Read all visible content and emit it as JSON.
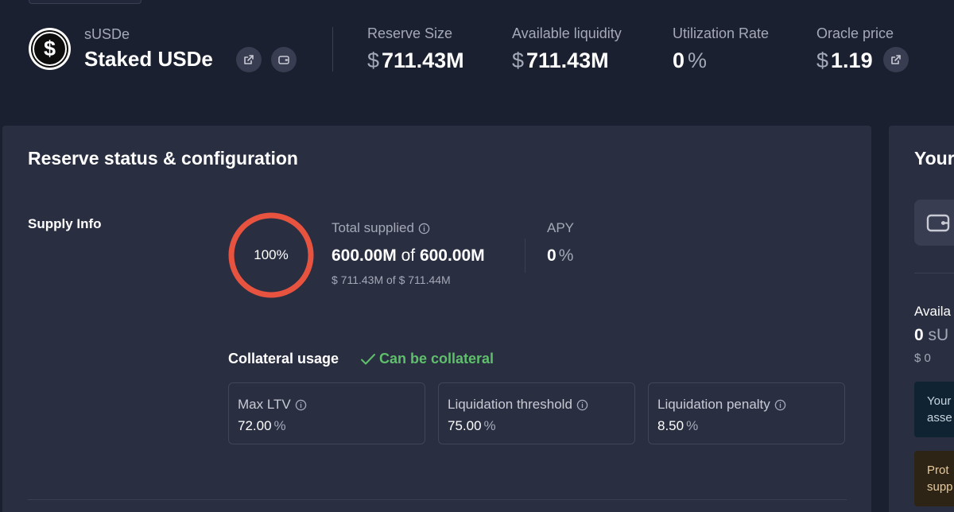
{
  "asset": {
    "symbol": "sUSDe",
    "name": "Staked USDe",
    "logo_glyph": "$"
  },
  "stats": {
    "reserve_size": {
      "label": "Reserve Size",
      "currency": "$",
      "value": "711.43M"
    },
    "available_liquidity": {
      "label": "Available liquidity",
      "currency": "$",
      "value": "711.43M"
    },
    "utilization_rate": {
      "label": "Utilization Rate",
      "value": "0",
      "unit": "%"
    },
    "oracle_price": {
      "label": "Oracle price",
      "currency": "$",
      "value": "1.19"
    }
  },
  "reserve_panel": {
    "title": "Reserve status & configuration",
    "supply_info": {
      "section_label": "Supply Info",
      "ring_percent_label": "100%",
      "ring_fill_fraction": 1.0,
      "ring_color": "#e8533f",
      "total_supplied_label": "Total supplied",
      "total_supplied_amount": "600.00M",
      "total_supplied_of": "of",
      "total_supplied_cap": "600.00M",
      "total_supplied_usd": "$ 711.43M of $ 711.44M",
      "apy_label": "APY",
      "apy_value": "0",
      "apy_unit": "%"
    },
    "collateral": {
      "label": "Collateral usage",
      "status": "Can be collateral",
      "status_color": "#5fbf6b",
      "cards": [
        {
          "label": "Max LTV",
          "value": "72.00",
          "unit": "%"
        },
        {
          "label": "Liquidation threshold",
          "value": "75.00",
          "unit": "%"
        },
        {
          "label": "Liquidation penalty",
          "value": "8.50",
          "unit": "%"
        }
      ]
    }
  },
  "right_panel": {
    "title_partial": "Your",
    "available_partial": "Availa",
    "amount_value": "0",
    "amount_symbol_partial": "sU",
    "usd_value": "$ 0",
    "notice_blue_lines": [
      "Your",
      "asse"
    ],
    "notice_warn_lines": [
      "Prot",
      "supp"
    ]
  },
  "icons": {
    "external_link": "external-link-icon",
    "wallet": "wallet-icon",
    "info": "info-icon",
    "check": "check-icon"
  }
}
